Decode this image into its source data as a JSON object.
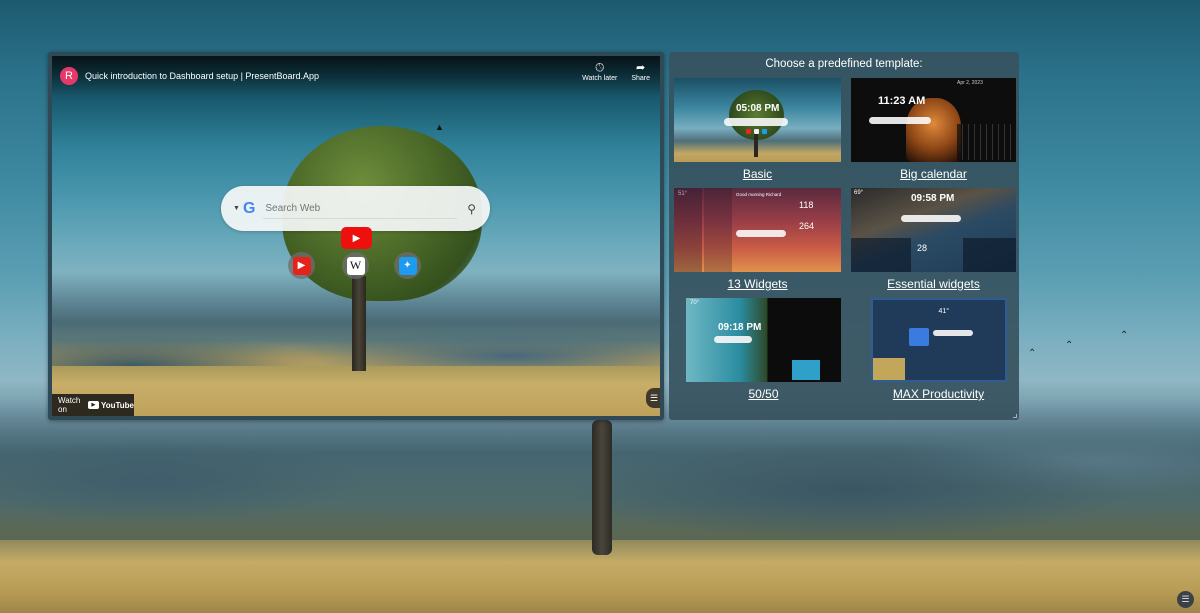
{
  "video": {
    "channel_initial": "R",
    "title": "Quick introduction to Dashboard setup | PresentBoard.App",
    "actions": [
      {
        "label": "Watch later",
        "icon": "clock-icon"
      },
      {
        "label": "Share",
        "icon": "share-icon"
      }
    ],
    "search": {
      "engine": "G",
      "placeholder": "Search Web",
      "button_icon": "search-icon"
    },
    "shortcuts": [
      {
        "name": "YouTube",
        "icon": "youtube-icon"
      },
      {
        "name": "Wikipedia",
        "icon": "wikipedia-icon",
        "glyph": "W"
      },
      {
        "name": "Twitter",
        "icon": "twitter-icon"
      }
    ],
    "watch_on_label": "Watch on",
    "youtube_brand": "YouTube",
    "menu_icon": "☰"
  },
  "templates": {
    "heading": "Choose a predefined template:",
    "items": [
      {
        "label": "Basic",
        "clock": "05:08 PM"
      },
      {
        "label": "Big calendar",
        "clock": "11:23 AM",
        "date": "Apr 2, 2023"
      },
      {
        "label": "13 Widgets",
        "greeting": "Good morning Richard",
        "stat1": "118",
        "stat2": "264",
        "weather": "51°"
      },
      {
        "label": "Essential widgets",
        "clock": "09:58 PM",
        "weather": "69°",
        "day": "28"
      },
      {
        "label": "50/50",
        "clock": "09:18 PM",
        "weather": "70°"
      },
      {
        "label": "MAX Productivity",
        "weather": "41°"
      }
    ]
  },
  "page": {
    "menu_icon": "☰"
  }
}
